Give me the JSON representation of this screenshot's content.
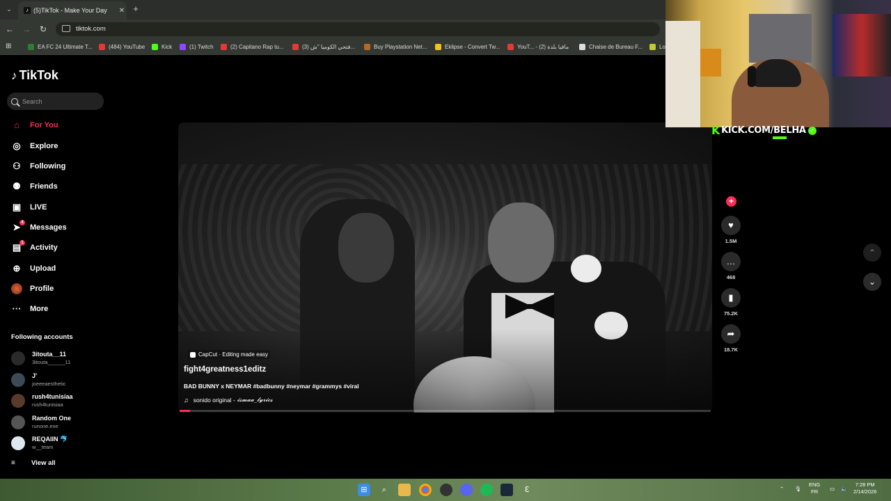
{
  "browser": {
    "tab_title": "(5)TikTok - Make Your Day",
    "url": "tiktok.com",
    "bookmarks": [
      {
        "label": "EA FC 24 Ultimate T...",
        "color": "#2e7d32"
      },
      {
        "label": "(484) YouTube",
        "color": "#e53935"
      },
      {
        "label": "Kick",
        "color": "#53fc18"
      },
      {
        "label": "(1) Twitch",
        "color": "#9146ff"
      },
      {
        "label": "(2) Capitano Rap tu...",
        "color": "#e53935"
      },
      {
        "label": "(3) فتحي الكوميا \"ش...",
        "color": "#e53935"
      },
      {
        "label": "Buy Playstation Net...",
        "color": "#b26a2a"
      },
      {
        "label": "Eklipse - Convert Tw...",
        "color": "#f0c419"
      },
      {
        "label": "YouT... - مافيا بلدة (2)",
        "color": "#e53935"
      },
      {
        "label": "Chaise de Bureau F...",
        "color": "#dddddd"
      },
      {
        "label": "Lo",
        "color": "#c0ca33"
      }
    ]
  },
  "tiktok": {
    "logo": "TikTok",
    "search_placeholder": "Search",
    "nav": [
      {
        "label": "For You",
        "icon": "home-icon",
        "active": true
      },
      {
        "label": "Explore",
        "icon": "compass-icon"
      },
      {
        "label": "Following",
        "icon": "following-icon"
      },
      {
        "label": "Friends",
        "icon": "friends-icon"
      },
      {
        "label": "LIVE",
        "icon": "live-icon"
      },
      {
        "label": "Messages",
        "icon": "messages-icon",
        "badge": "4"
      },
      {
        "label": "Activity",
        "icon": "activity-icon",
        "badge": "1"
      },
      {
        "label": "Upload",
        "icon": "upload-icon"
      },
      {
        "label": "Profile",
        "icon": "profile-icon"
      },
      {
        "label": "More",
        "icon": "more-icon"
      }
    ],
    "following_title": "Following accounts",
    "accounts": [
      {
        "name": "3itouta__11",
        "handle": "3itouta______11"
      },
      {
        "name": "J'",
        "handle": "joeeeaesthetic"
      },
      {
        "name": "rush4tunisiaa",
        "handle": "rush4tunisiaa"
      },
      {
        "name": "Random One",
        "handle": "runone.exe"
      },
      {
        "name": "REQAIIN 🐬",
        "handle": "w__team"
      }
    ],
    "view_all": "View all",
    "video": {
      "capcut_label": "CapCut · Editing made easy",
      "author": "fight4greatness1editz",
      "description": "BAD BUNNY x NEYMAR #badbunny #neymar #grammys #viral",
      "sound_prefix": "sonido original -",
      "sound_name": "𝓲𝓼𝓶𝓪𝓪_𝓵𝔂𝓻𝓲𝓬𝓼",
      "progress": 0.02
    },
    "actions": [
      {
        "icon": "heart-icon",
        "count": "1.5M"
      },
      {
        "icon": "comment-icon",
        "count": "468"
      },
      {
        "icon": "bookmark-icon",
        "count": "75.2K"
      },
      {
        "icon": "share-icon",
        "count": "18.7K"
      }
    ]
  },
  "overlay": {
    "kick_text": "KICK.COM/BELHA"
  },
  "taskbar": {
    "lang_top": "ENG",
    "lang_bottom": "FR",
    "time": "7:28 PM",
    "date": "2/14/2026"
  }
}
